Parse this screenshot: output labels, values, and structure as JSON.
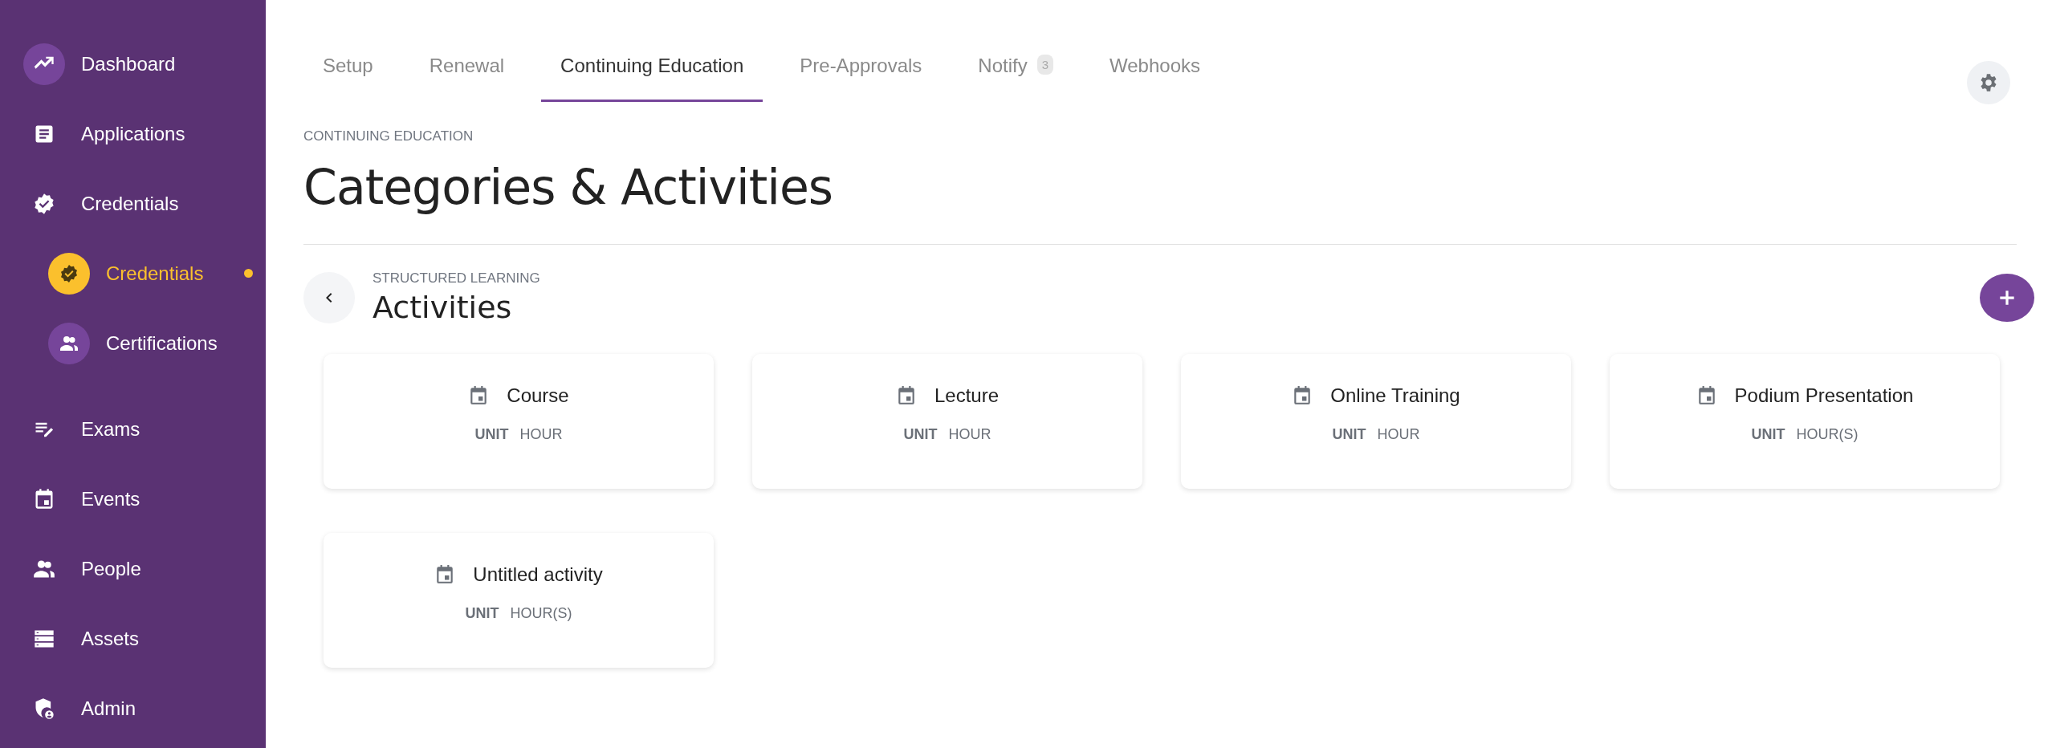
{
  "sidebar": {
    "items": [
      {
        "label": "Dashboard",
        "highlighted": true
      },
      {
        "label": "Applications",
        "highlighted": false
      },
      {
        "label": "Credentials",
        "highlighted": false,
        "children": [
          {
            "label": "Credentials",
            "selected": true
          },
          {
            "label": "Certifications",
            "selected": false
          }
        ]
      },
      {
        "label": "Exams",
        "highlighted": false
      },
      {
        "label": "Events",
        "highlighted": false
      },
      {
        "label": "People",
        "highlighted": false
      },
      {
        "label": "Assets",
        "highlighted": false
      },
      {
        "label": "Admin",
        "highlighted": false
      }
    ]
  },
  "tabs": [
    {
      "label": "Setup",
      "selected": false
    },
    {
      "label": "Renewal",
      "selected": false
    },
    {
      "label": "Continuing Education",
      "selected": true
    },
    {
      "label": "Pre-Approvals",
      "selected": false
    },
    {
      "label": "Notify",
      "selected": false,
      "badge": "3"
    },
    {
      "label": "Webhooks",
      "selected": false
    }
  ],
  "header": {
    "eyebrow": "CONTINUING EDUCATION",
    "title": "Categories & Activities"
  },
  "section": {
    "eyebrow": "STRUCTURED LEARNING",
    "title": "Activities"
  },
  "activities": [
    {
      "name": "Course",
      "unit_label": "UNIT",
      "unit": "HOUR"
    },
    {
      "name": "Lecture",
      "unit_label": "UNIT",
      "unit": "HOUR"
    },
    {
      "name": "Online Training",
      "unit_label": "UNIT",
      "unit": "HOUR"
    },
    {
      "name": "Podium Presentation",
      "unit_label": "UNIT",
      "unit": "HOUR(S)"
    },
    {
      "name": "Untitled activity",
      "unit_label": "UNIT",
      "unit": "HOUR(S)"
    }
  ]
}
